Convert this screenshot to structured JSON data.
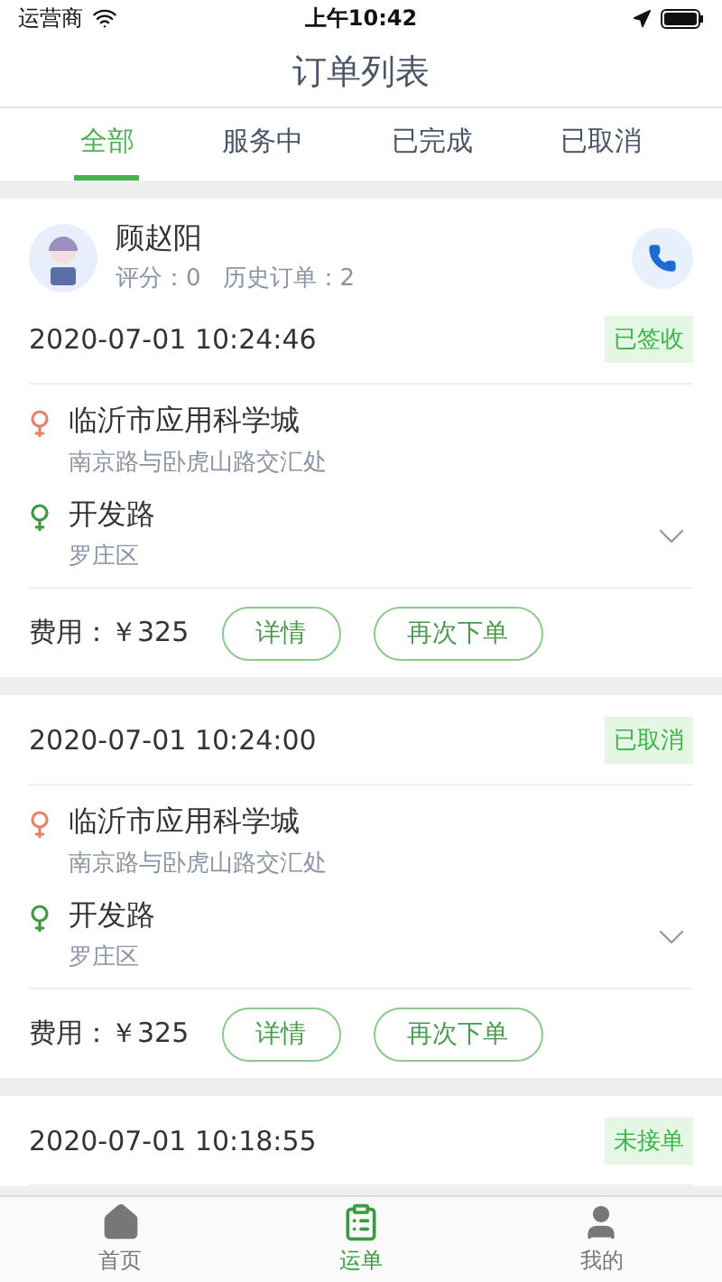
{
  "status_bar": {
    "carrier": "运营商",
    "time": "上午10:42"
  },
  "title": "订单列表",
  "tabs": [
    {
      "label": "全部",
      "selected": true
    },
    {
      "label": "服务中",
      "selected": false
    },
    {
      "label": "已完成",
      "selected": false
    },
    {
      "label": "已取消",
      "selected": false
    }
  ],
  "orders": [
    {
      "customer": {
        "name": "顾赵阳",
        "rating": "评分：0",
        "history": "历史订单：2"
      },
      "time": "2020-07-01 10:24:46",
      "status": "已签收",
      "from": {
        "name": "临沂市应用科学城",
        "detail": "南京路与卧虎山路交汇处"
      },
      "to": {
        "name": "开发路",
        "detail": "罗庄区"
      },
      "fee": "费用：￥325",
      "buttons": [
        "详情",
        "再次下单"
      ]
    },
    {
      "time": "2020-07-01 10:24:00",
      "status": "已取消",
      "from": {
        "name": "临沂市应用科学城",
        "detail": "南京路与卧虎山路交汇处"
      },
      "to": {
        "name": "开发路",
        "detail": "罗庄区"
      },
      "fee": "费用：￥325",
      "buttons": [
        "详情",
        "再次下单"
      ]
    },
    {
      "time": "2020-07-01 10:18:55",
      "status": "未接单"
    }
  ],
  "bottom_nav": [
    {
      "label": "首页",
      "kind": "home",
      "selected": false
    },
    {
      "label": "运单",
      "kind": "orders",
      "selected": true
    },
    {
      "label": "我的",
      "kind": "profile",
      "selected": false
    }
  ]
}
